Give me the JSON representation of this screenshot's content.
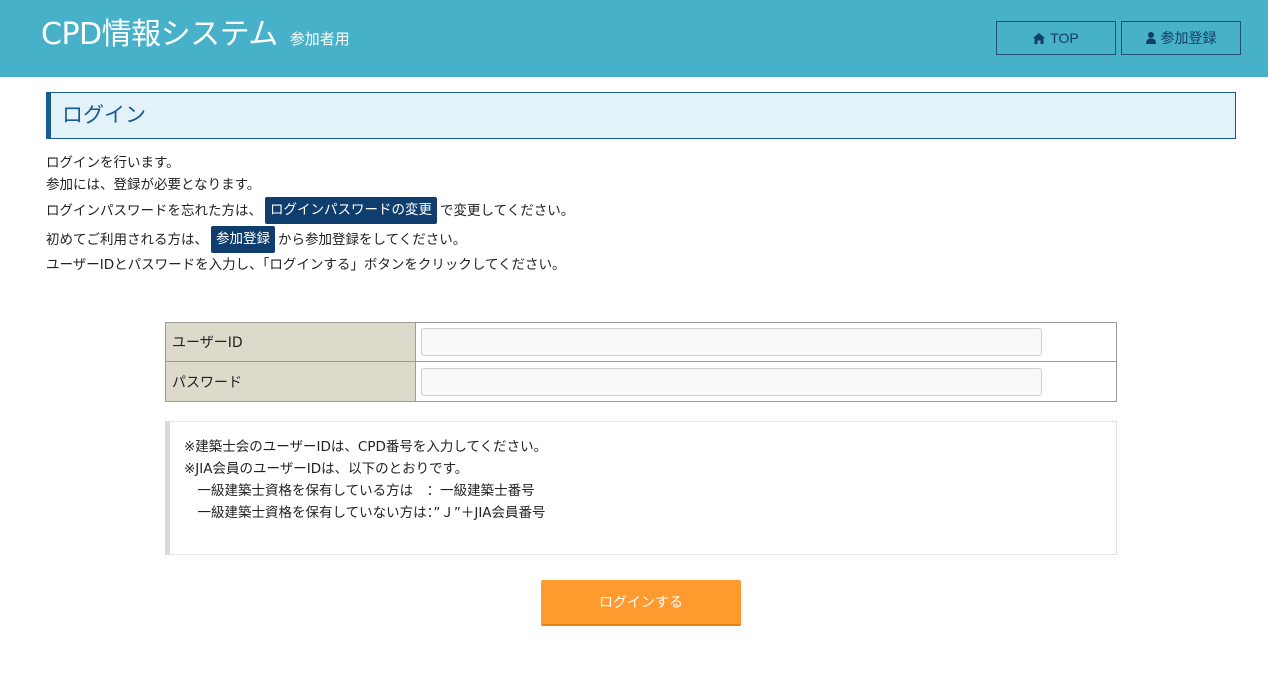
{
  "header": {
    "title": "CPD情報システム",
    "subtitle": "参加者用",
    "nav": {
      "top_label": "TOP",
      "register_label": "参加登録"
    }
  },
  "panel": {
    "title": "ログイン"
  },
  "intro": {
    "line1": "ログインを行います。",
    "line2": "参加には、登録が必要となります。",
    "line3_before": "ログインパスワードを忘れた方は、",
    "line3_link": "ログインパスワードの変更",
    "line3_after": "で変更してください。",
    "line4_before": "初めてご利用される方は、",
    "line4_link": "参加登録",
    "line4_after": "から参加登録をしてください。",
    "line5": "ユーザーIDとパスワードを入力し、「ログインする」ボタンをクリックしてください。"
  },
  "form": {
    "user_id_label": "ユーザーID",
    "user_id_value": "",
    "password_label": "パスワード",
    "password_value": ""
  },
  "note": {
    "line1": "※建築士会のユーザーIDは、CPD番号を入力してください。",
    "line2": "※JIA会員のユーザーIDは、以下のとおりです。",
    "line3": "　一級建築士資格を保有している方は　：一級建築士番号",
    "line4": "　一級建築士資格を保有していない方は：”Ｊ”＋JIA会員番号"
  },
  "login_button": "ログインする",
  "colors": {
    "header_bg": "#46b1c9",
    "accent_navy": "#0f3d6d",
    "panel_border": "#1b5a8e",
    "login_orange": "#ff9a2e"
  }
}
